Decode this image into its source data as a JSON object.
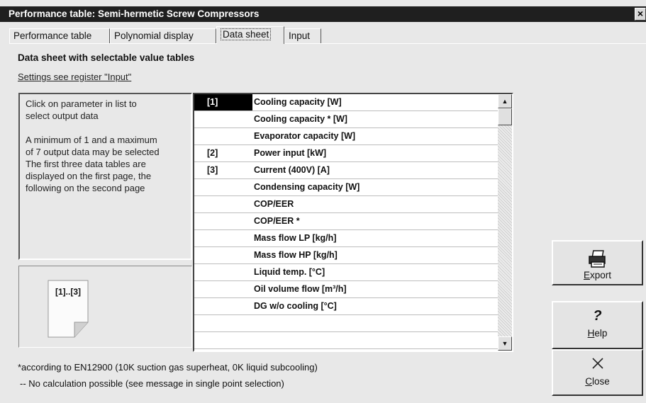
{
  "window": {
    "title": "Performance table: Semi-hermetic Screw Compressors",
    "close_label": "×"
  },
  "tabs": [
    {
      "label": "Performance table"
    },
    {
      "label": "Polynomial display"
    },
    {
      "label": "Data sheet"
    },
    {
      "label": "Input"
    }
  ],
  "main": {
    "heading": "Data sheet with selectable value tables",
    "settings_link": "Settings see register \"Input\"",
    "info": {
      "line1": "Click on parameter in list to",
      "line2": "select output data",
      "line3": "A minimum of 1 and a maximum",
      "line4": "of 7 output data may be selected",
      "line5": "The first three data tables are",
      "line6": "displayed on the first page, the",
      "line7": "following on the second page"
    },
    "page_icon_label": "[1]..[3]",
    "list": [
      {
        "selector": "[1]",
        "name": "Cooling capacity [W]",
        "active": true
      },
      {
        "selector": "",
        "name": "Cooling capacity * [W]"
      },
      {
        "selector": "",
        "name": "Evaporator capacity [W]"
      },
      {
        "selector": "[2]",
        "name": "Power input [kW]"
      },
      {
        "selector": "[3]",
        "name": "Current (400V) [A]"
      },
      {
        "selector": "",
        "name": "Condensing capacity [W]"
      },
      {
        "selector": "",
        "name": "COP/EER"
      },
      {
        "selector": "",
        "name": "COP/EER *"
      },
      {
        "selector": "",
        "name": "Mass flow LP [kg/h]"
      },
      {
        "selector": "",
        "name": "Mass flow HP [kg/h]"
      },
      {
        "selector": "",
        "name": "Liquid temp. [°C]"
      },
      {
        "selector": "",
        "name": "Oil volume flow [m³/h]"
      },
      {
        "selector": "",
        "name": "DG w/o cooling [°C]"
      },
      {
        "selector": "",
        "name": ""
      },
      {
        "selector": "",
        "name": ""
      }
    ],
    "footnote1": "*according to EN12900 (10K suction gas superheat, 0K liquid subcooling)",
    "footnote2": "-- No calculation possible (see message in single point selection)"
  },
  "buttons": {
    "export": {
      "underlined": "E",
      "rest": "xport",
      "icon": "printer-icon"
    },
    "help": {
      "underlined": "H",
      "rest": "elp",
      "icon": "question-mark-icon"
    },
    "close": {
      "underlined": "C",
      "rest": "lose",
      "icon": "close-x-icon"
    }
  }
}
